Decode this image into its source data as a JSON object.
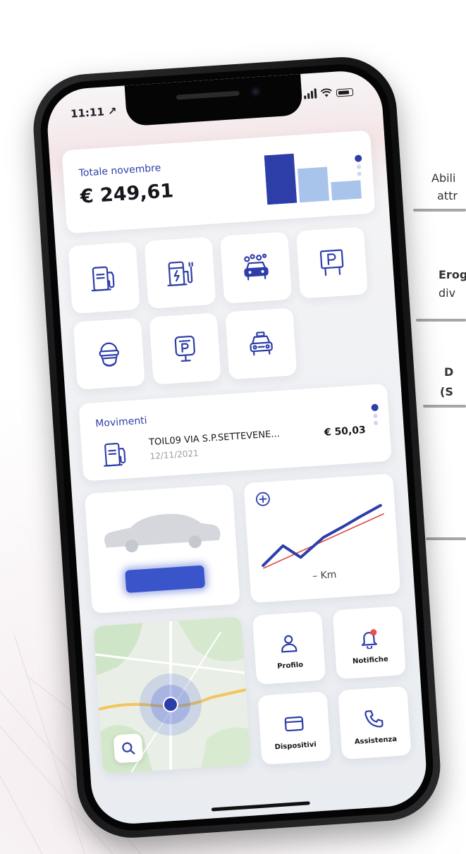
{
  "status_bar": {
    "time": "11:11 ↗"
  },
  "summary": {
    "label": "Totale novembre",
    "amount": "€ 249,61"
  },
  "services": [
    {
      "icon": "fuel-pump-icon"
    },
    {
      "icon": "ev-charger-icon"
    },
    {
      "icon": "car-wash-icon"
    },
    {
      "icon": "parking-icon"
    },
    {
      "icon": "ferry-icon"
    },
    {
      "icon": "parking-meter-icon"
    },
    {
      "icon": "taxi-icon"
    }
  ],
  "movements": {
    "title": "Movimenti",
    "item": {
      "name": "TOIL09 VIA S.P.SETTEVENE...",
      "date": "12/11/2021",
      "amount": "€ 50,03",
      "icon": "fuel-pump-icon"
    }
  },
  "km_widget": {
    "label": "– Km"
  },
  "quick_actions": [
    {
      "label": "Profilo",
      "icon": "person-icon"
    },
    {
      "label": "Notifiche",
      "icon": "bell-icon"
    },
    {
      "label": "Dispositivi",
      "icon": "card-icon"
    },
    {
      "label": "Assistenza",
      "icon": "phone-icon"
    }
  ],
  "side_captions": [
    "Abili",
    "attr",
    "Erog",
    "div",
    "D",
    "(S"
  ],
  "colors": {
    "accent": "#2d3ea8",
    "accent_light": "#a9c4ea",
    "notification": "#e8504a",
    "trend_line": "#e04545"
  }
}
